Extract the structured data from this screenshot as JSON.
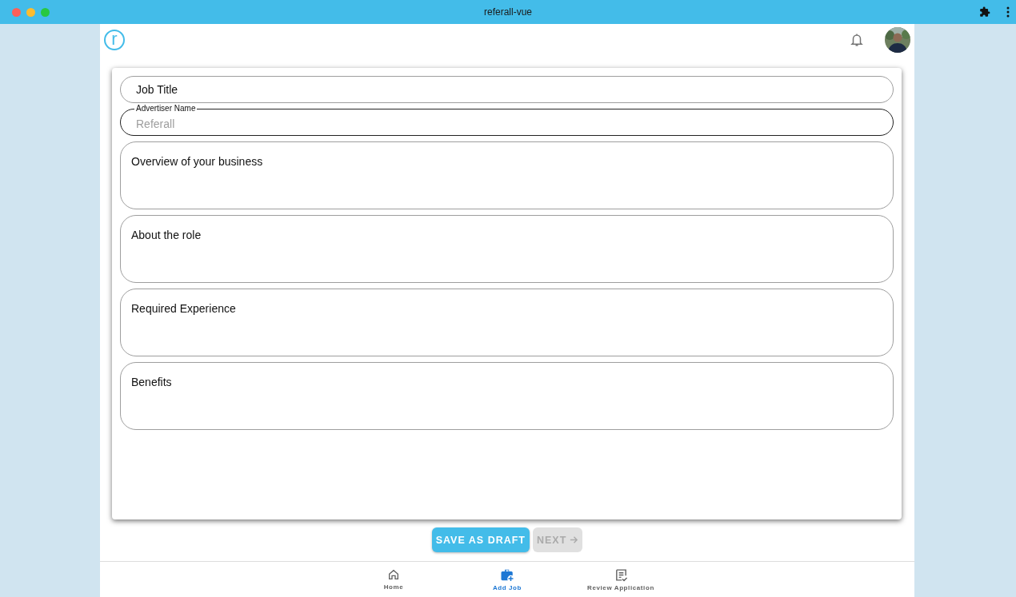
{
  "window": {
    "title": "referall-vue"
  },
  "header": {
    "logo": "r"
  },
  "form": {
    "fields": [
      {
        "kind": "input",
        "placeholder": "Job Title",
        "disabled": false
      },
      {
        "kind": "input",
        "label": "Advertiser Name",
        "value": "Referall",
        "disabled": true
      },
      {
        "kind": "textarea",
        "placeholder": "Overview of your business",
        "disabled": false
      },
      {
        "kind": "textarea",
        "placeholder": "About the role",
        "disabled": false
      },
      {
        "kind": "textarea",
        "placeholder": "Required Experience",
        "disabled": false
      },
      {
        "kind": "textarea",
        "placeholder": "Benefits",
        "disabled": false
      }
    ]
  },
  "actions": [
    {
      "label": "SAVE AS DRAFT",
      "disabled": false,
      "arrow": false
    },
    {
      "label": "NEXT",
      "disabled": true,
      "arrow": true
    }
  ],
  "bottom_nav": [
    {
      "kind": "home",
      "label": "Home",
      "selected": false
    },
    {
      "kind": "add-job",
      "label": "Add Job",
      "selected": true
    },
    {
      "kind": "review",
      "label": "Review Application",
      "selected": false
    }
  ]
}
